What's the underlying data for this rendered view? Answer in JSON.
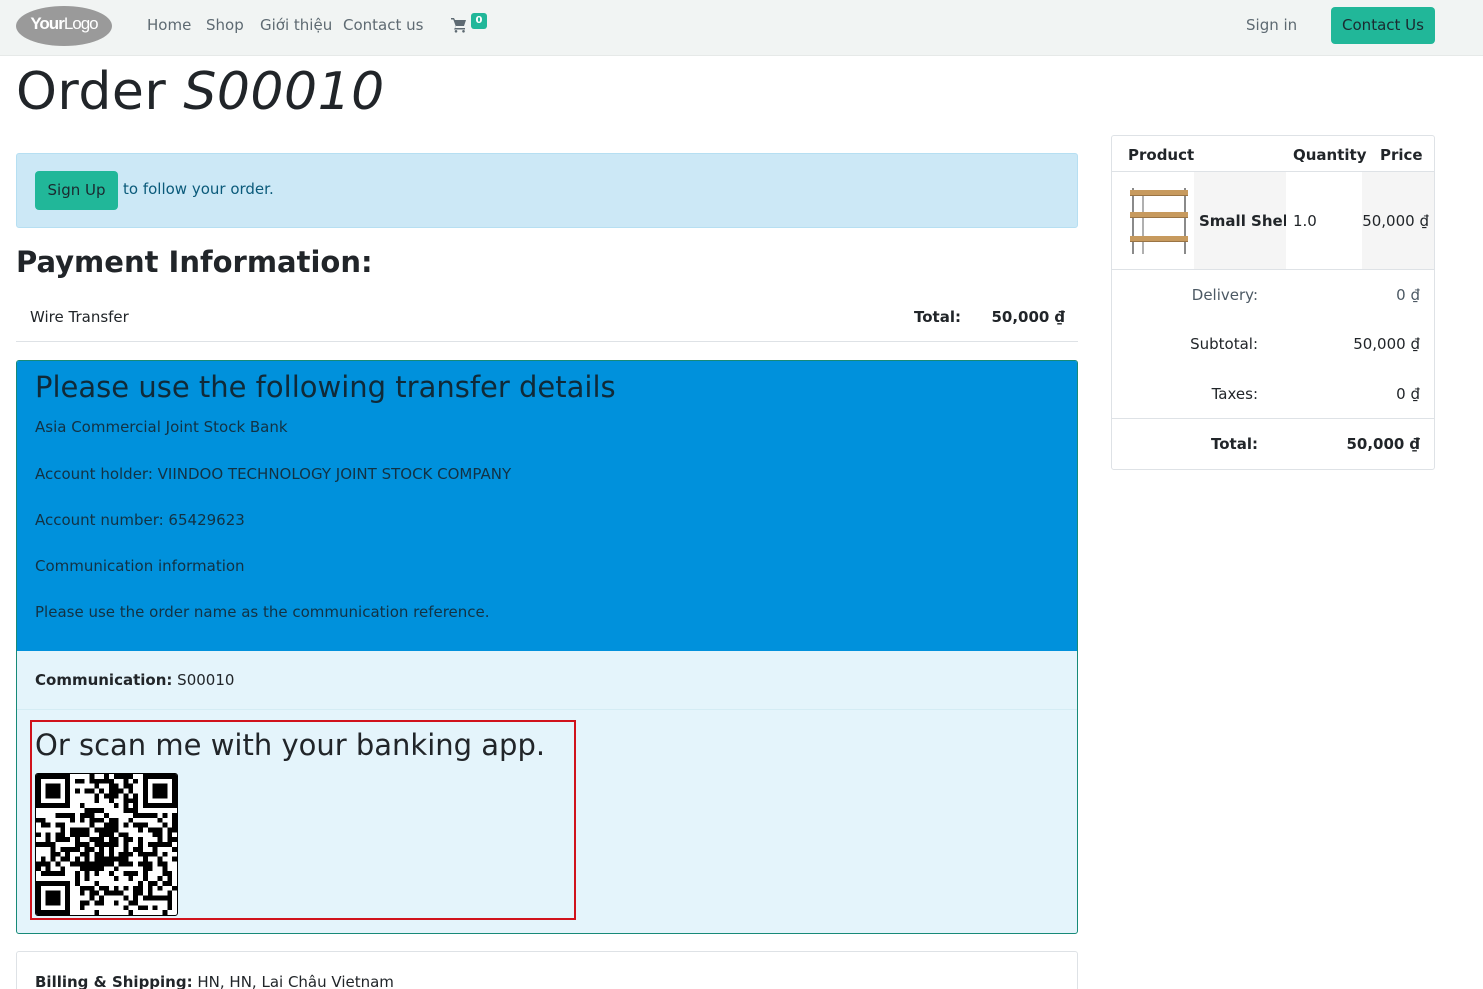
{
  "nav": {
    "logo_bold": "Your",
    "logo_light": "Logo",
    "links": [
      "Home",
      "Shop",
      "Giới thiệu",
      "Contact us"
    ],
    "cart_count": "0",
    "signin": "Sign in",
    "contact_btn": "Contact Us"
  },
  "page": {
    "title_prefix": "Order ",
    "title_order": "S00010"
  },
  "signup": {
    "button": "Sign Up",
    "text": "to follow your order."
  },
  "payment": {
    "heading": "Payment Information:",
    "method": "Wire Transfer",
    "total_label": "Total:",
    "total_value": "50,000 ₫"
  },
  "transfer": {
    "title": "Please use the following transfer details",
    "bank": "Asia Commercial Joint Stock Bank",
    "holder": "Account holder: VIINDOO TECHNOLOGY JOINT STOCK COMPANY",
    "number": "Account number: 65429623",
    "comm_info": "Communication information",
    "comm_note": "Please use the order name as the communication reference.",
    "comm_label": "Communication:",
    "comm_value": "S00010",
    "scan_title": "Or scan me with your banking app."
  },
  "billing": {
    "label": "Billing & Shipping:",
    "value": "HN, HN, Lai Châu Vietnam"
  },
  "summary": {
    "headers": {
      "product": "Product",
      "quantity": "Quantity",
      "price": "Price"
    },
    "item": {
      "name": "Small Shelf",
      "qty": "1.0",
      "price": "50,000 ₫"
    },
    "delivery_label": "Delivery:",
    "delivery_value": "0 ₫",
    "subtotal_label": "Subtotal:",
    "subtotal_value": "50,000 ₫",
    "taxes_label": "Taxes:",
    "taxes_value": "0 ₫",
    "total_label": "Total:",
    "total_value": "50,000 ₫"
  },
  "colors": {
    "primary": "#21b799",
    "transfer_head": "#0091dc",
    "transfer_body": "#e4f4fb",
    "alert": "#cce8f6",
    "highlight_border": "#d0121b"
  },
  "icons": {
    "cart": "shopping-cart-icon",
    "qr": "qr-code-image",
    "product": "shelf-product-image"
  }
}
